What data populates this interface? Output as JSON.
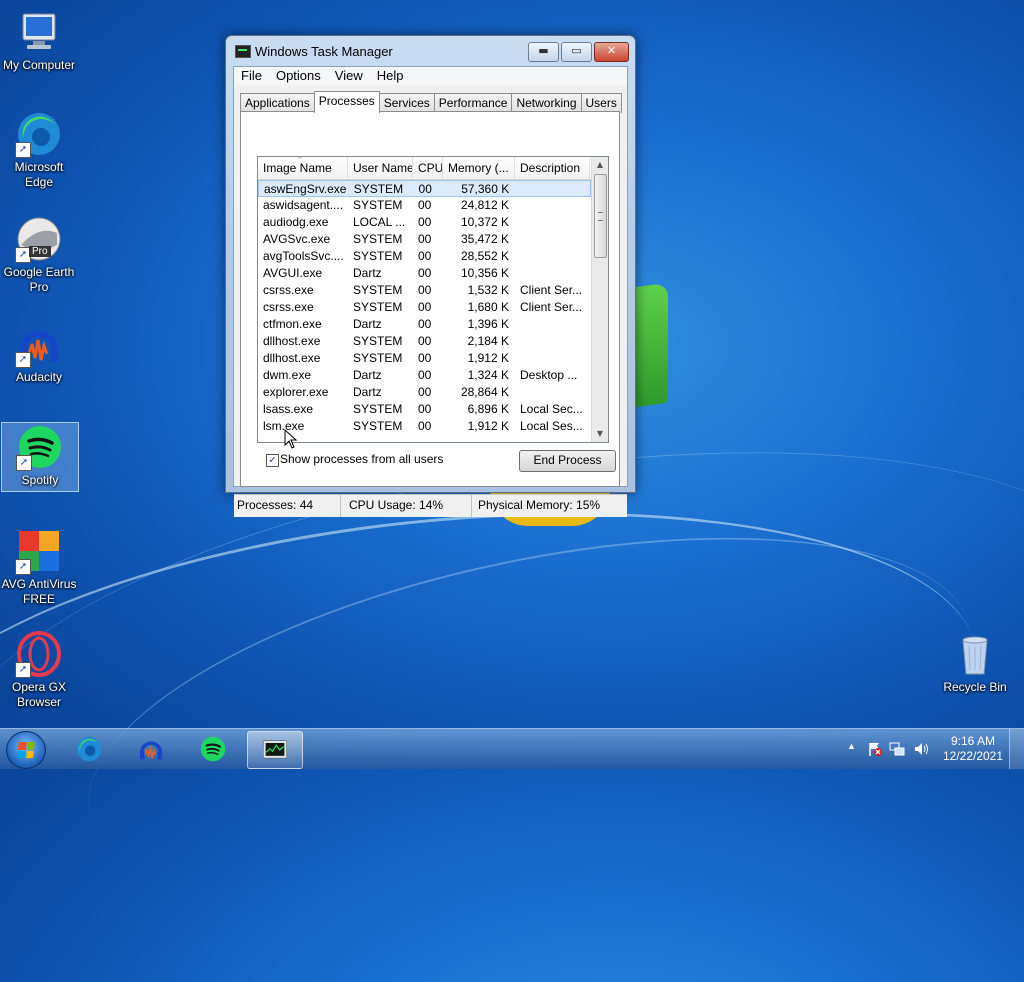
{
  "desktop": {
    "icons": [
      {
        "label": "My Computer"
      },
      {
        "label": "Microsoft Edge"
      },
      {
        "label": "Google Earth Pro",
        "badge": "Pro"
      },
      {
        "label": "Audacity"
      },
      {
        "label": "Spotify"
      },
      {
        "label": "AVG AntiVirus FREE"
      },
      {
        "label": "Opera GX Browser"
      },
      {
        "label": "Recycle Bin"
      }
    ]
  },
  "window": {
    "title": "Windows Task Manager",
    "controls": {
      "minimize": "▬",
      "maximize": "▭",
      "close": "✕"
    },
    "menu": [
      "File",
      "Options",
      "View",
      "Help"
    ],
    "tabs": [
      "Applications",
      "Processes",
      "Services",
      "Performance",
      "Networking",
      "Users"
    ],
    "active_tab": "Processes",
    "columns": [
      "Image Name",
      "User Name",
      "CPU",
      "Memory (...",
      "Description"
    ],
    "sort_indicator": "^",
    "rows": [
      [
        "aswEngSrv.exe",
        "SYSTEM",
        "00",
        "57,360 K",
        ""
      ],
      [
        "aswidsagent....",
        "SYSTEM",
        "00",
        "24,812 K",
        ""
      ],
      [
        "audiodg.exe",
        "LOCAL ...",
        "00",
        "10,372 K",
        ""
      ],
      [
        "AVGSvc.exe",
        "SYSTEM",
        "00",
        "35,472 K",
        ""
      ],
      [
        "avgToolsSvc....",
        "SYSTEM",
        "00",
        "28,552 K",
        ""
      ],
      [
        "AVGUI.exe",
        "Dartz",
        "00",
        "10,356 K",
        ""
      ],
      [
        "csrss.exe",
        "SYSTEM",
        "00",
        "1,532 K",
        "Client Ser..."
      ],
      [
        "csrss.exe",
        "SYSTEM",
        "00",
        "1,680 K",
        "Client Ser..."
      ],
      [
        "ctfmon.exe",
        "Dartz",
        "00",
        "1,396 K",
        ""
      ],
      [
        "dllhost.exe",
        "SYSTEM",
        "00",
        "2,184 K",
        ""
      ],
      [
        "dllhost.exe",
        "SYSTEM",
        "00",
        "1,912 K",
        ""
      ],
      [
        "dwm.exe",
        "Dartz",
        "00",
        "1,324 K",
        "Desktop ..."
      ],
      [
        "explorer.exe",
        "Dartz",
        "00",
        "28,864 K",
        ""
      ],
      [
        "lsass.exe",
        "SYSTEM",
        "00",
        "6,896 K",
        "Local Sec..."
      ],
      [
        "lsm.exe",
        "SYSTEM",
        "00",
        "1,912 K",
        "Local Ses..."
      ]
    ],
    "selected_row": 0,
    "show_all_label": "Show processes from all users",
    "show_all_checked": true,
    "check_mark": "✓",
    "end_process_label": "End Process",
    "status": {
      "processes": "Processes: 44",
      "cpu": "CPU Usage: 14%",
      "memory": "Physical Memory: 15%"
    }
  },
  "taskbar": {
    "apps": [
      "edge-icon",
      "audacity-icon",
      "spotify-icon",
      "task-manager-icon"
    ],
    "tray_arrow": "▲",
    "clock_time": "9:16 AM",
    "clock_date": "12/22/2021"
  }
}
